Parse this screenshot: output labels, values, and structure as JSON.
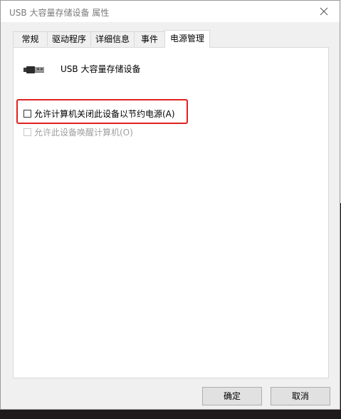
{
  "window": {
    "title": "USB 大容量存储设备 属性"
  },
  "tabs": [
    {
      "label": "常规"
    },
    {
      "label": "驱动程序"
    },
    {
      "label": "详细信息"
    },
    {
      "label": "事件"
    },
    {
      "label": "电源管理",
      "active": true
    }
  ],
  "device": {
    "name": "USB 大容量存储设备",
    "icon": "usb-plug-icon"
  },
  "options": [
    {
      "label": "允许计算机关闭此设备以节约电源(A)",
      "checked": false,
      "enabled": true,
      "highlighted": true
    },
    {
      "label": "允许此设备唤醒计算机(O)",
      "checked": false,
      "enabled": false
    }
  ],
  "buttons": {
    "ok": "确定",
    "cancel": "取消"
  },
  "colors": {
    "highlight": "#e02020",
    "disabled_text": "#a0a0a0"
  }
}
